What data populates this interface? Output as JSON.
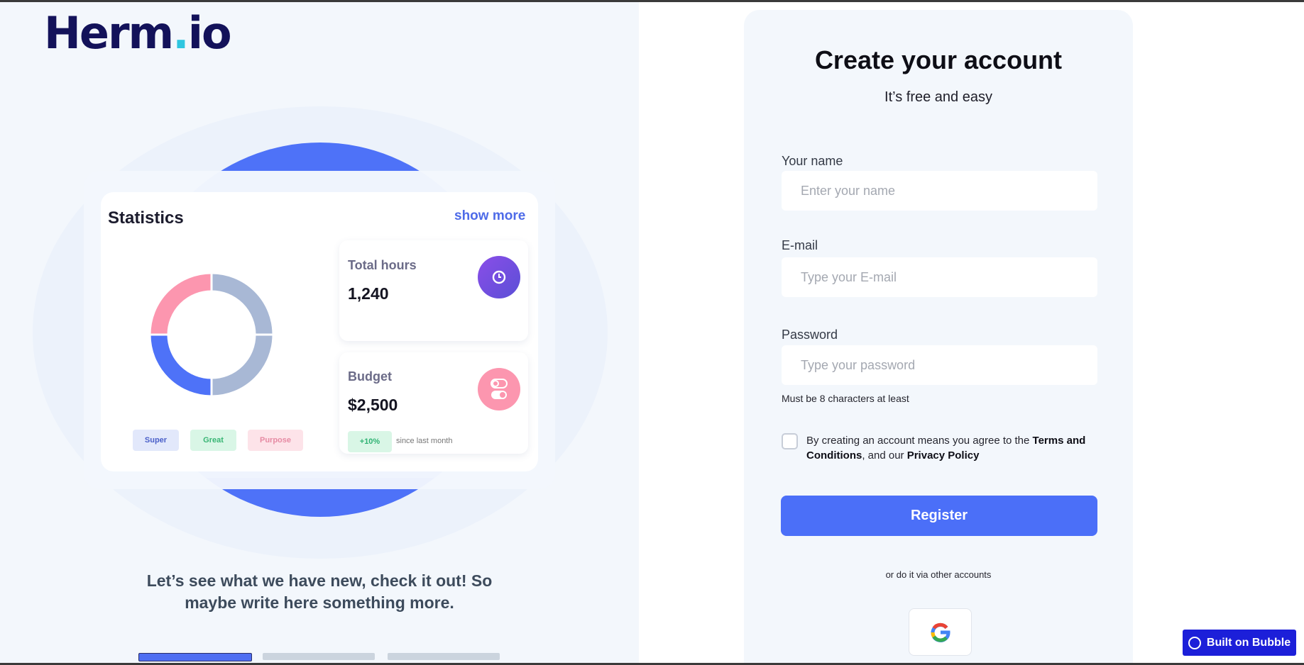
{
  "brand": {
    "logo_main": "Herm",
    "logo_dot": ".",
    "logo_end": "io"
  },
  "stats": {
    "title": "Statistics",
    "show_more": "show more",
    "legend": [
      "Super",
      "Great",
      "Purpose"
    ],
    "total_hours": {
      "label": "Total hours",
      "value": "1,240",
      "icon": "clock-icon"
    },
    "budget": {
      "label": "Budget",
      "value": "$2,500",
      "delta": "+10%",
      "since": "since last month",
      "icon": "toggle-icon"
    }
  },
  "chart_data": {
    "type": "pie",
    "style": "donut",
    "categories": [
      "Super",
      "Great",
      "Purpose"
    ],
    "segments": [
      {
        "name": "Super",
        "share": 0.25,
        "color": "#4e72f8"
      },
      {
        "name": "Great",
        "share": 0.5,
        "color": "#a8b8d5"
      },
      {
        "name": "Purpose",
        "share": 0.25,
        "color": "#fc96af"
      }
    ]
  },
  "tagline": "Let’s see what we have new, check it out! So maybe write here something more.",
  "carousel": {
    "active": 1,
    "count": 3
  },
  "form": {
    "title": "Create your account",
    "subtitle": "It’s free and easy",
    "name_label": "Your name",
    "name_placeholder": "Enter your name",
    "email_label": "E-mail",
    "email_placeholder": "Type your E-mail",
    "password_label": "Password",
    "password_placeholder": "Type your password",
    "password_hint": "Must be 8 characters at least",
    "terms_prefix": "By creating an account means you agree to the ",
    "terms_link": "Terms and Conditions",
    "terms_middle": ", and our ",
    "privacy_link": "Privacy Policy",
    "register": "Register",
    "alt_text": "or do it via other accounts",
    "google_icon": "google-icon"
  },
  "badge": {
    "label": "Built on Bubble"
  },
  "colors": {
    "accent": "#4b6ff8",
    "brand": "#13125a",
    "purple": "#7b4fe0",
    "pink": "#fc96af"
  }
}
